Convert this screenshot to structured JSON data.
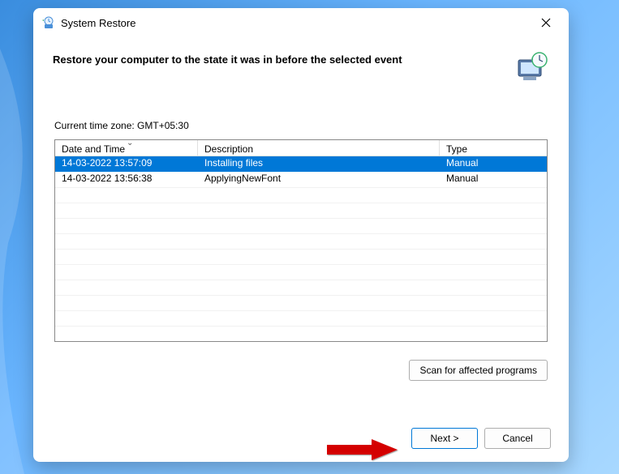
{
  "window": {
    "title": "System Restore"
  },
  "header": {
    "title": "Restore your computer to the state it was in before the selected event"
  },
  "timezone_line": "Current time zone: GMT+05:30",
  "columns": {
    "dt": "Date and Time",
    "desc": "Description",
    "type": "Type"
  },
  "rows": [
    {
      "dt": "14-03-2022 13:57:09",
      "desc": "Installing files",
      "type": "Manual",
      "selected": true
    },
    {
      "dt": "14-03-2022 13:56:38",
      "desc": "ApplyingNewFont",
      "type": "Manual",
      "selected": false
    }
  ],
  "buttons": {
    "scan": "Scan for affected programs",
    "next": "Next >",
    "cancel": "Cancel"
  }
}
